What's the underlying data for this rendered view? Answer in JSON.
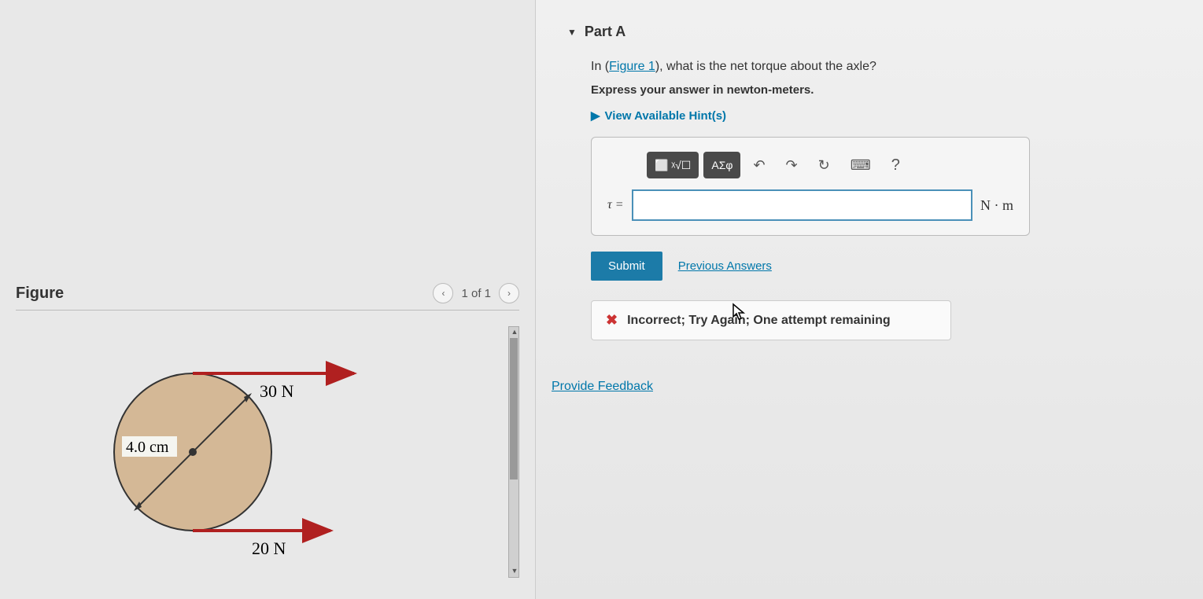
{
  "figure": {
    "title": "Figure",
    "nav_count": "1 of 1",
    "labels": {
      "radius": "4.0 cm",
      "force_top": "30 N",
      "force_bottom": "20 N"
    }
  },
  "part": {
    "label": "Part A",
    "question_prefix": "In (",
    "figure_link": "Figure 1",
    "question_suffix": "), what is the net torque about the axle?",
    "express": "Express your answer in newton-meters.",
    "hints": "View Available Hint(s)"
  },
  "toolbar": {
    "templates": "⬜ ᵡ√☐",
    "symbols": "ΑΣφ",
    "undo": "↶",
    "redo": "↷",
    "reset": "↻",
    "keyboard": "⌨",
    "help": "?"
  },
  "input": {
    "tau": "τ =",
    "value": "",
    "units": "N · m"
  },
  "actions": {
    "submit": "Submit",
    "previous": "Previous Answers"
  },
  "feedback": {
    "message": "Incorrect; Try Again; One attempt remaining"
  },
  "provide_feedback": "Provide Feedback"
}
